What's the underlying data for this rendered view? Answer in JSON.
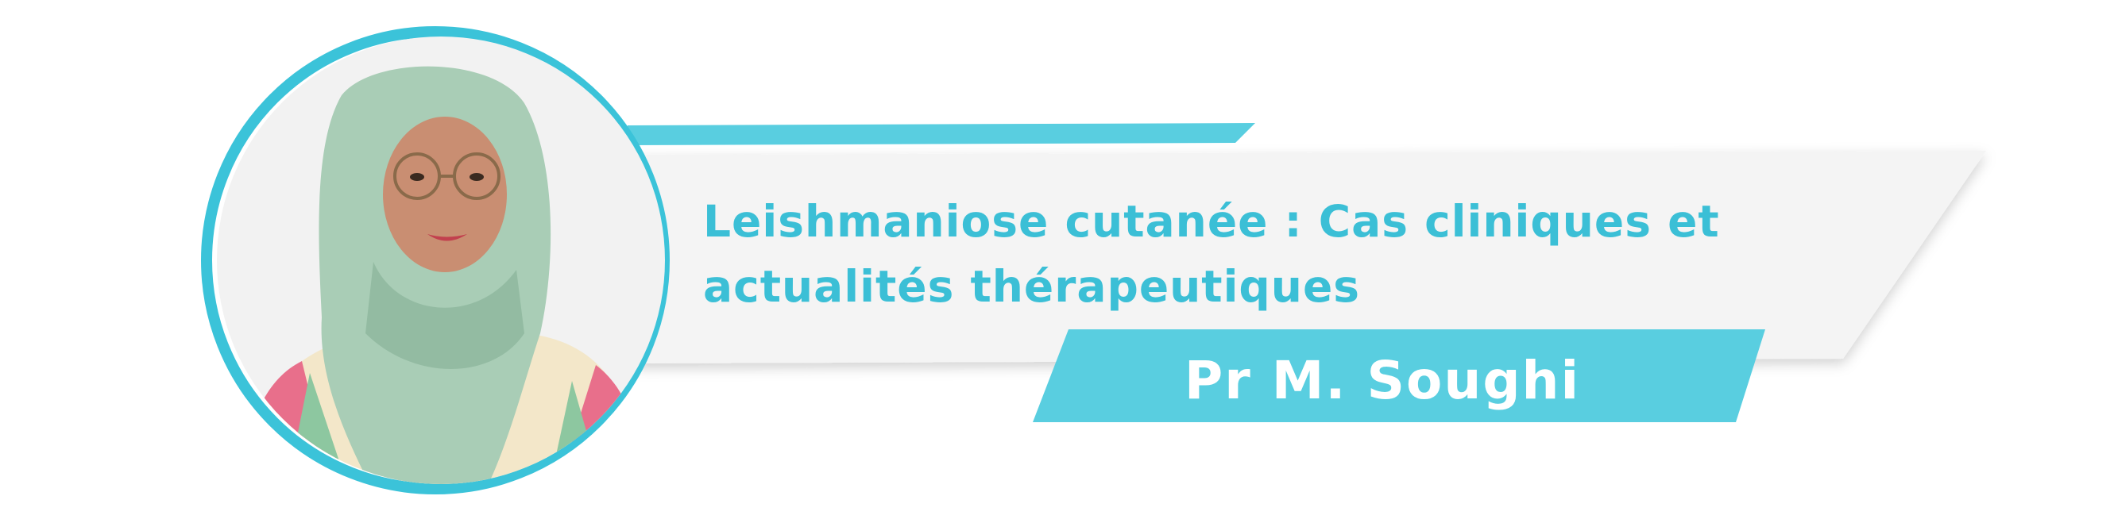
{
  "banner": {
    "title_line_1": "Leishmaniose cutanée :  Cas cliniques et",
    "title_line_2": "actualités thérapeutiques",
    "speaker": "Pr M. Soughi"
  },
  "colors": {
    "accent": "#59cee0",
    "title_text": "#3bbfd6",
    "panel": "#f4f4f4",
    "name_text": "#ffffff"
  },
  "portrait": {
    "icon": "portrait-photo",
    "scarf_color": "#a9cdb6",
    "jacket_colors": [
      "#e86f8b",
      "#f3e7c9",
      "#8dc7a0"
    ]
  }
}
